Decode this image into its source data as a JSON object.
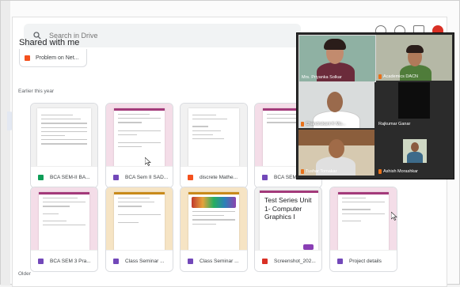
{
  "search": {
    "placeholder": "Search in Drive"
  },
  "page": {
    "heading": "Shared with me"
  },
  "previous_item": {
    "label": "Problem on Net..."
  },
  "sections": {
    "earlier": "Earlier this year",
    "older": "Older"
  },
  "row1": [
    {
      "label": "BCA SEM-II BA...",
      "icon": "sheets-icon",
      "icon_color": "#0f9d58"
    },
    {
      "label": "BCA Sem II SAD...",
      "icon": "forms-icon",
      "icon_color": "#7248b9"
    },
    {
      "label": "discrete Mathe...",
      "icon": "slides-icon",
      "icon_color": "#f4511e"
    },
    {
      "label": "BCA SEM",
      "icon": "forms-icon",
      "icon_color": "#7248b9"
    }
  ],
  "row2": [
    {
      "label": "BCA SEM 3 Pra...",
      "icon": "forms-icon",
      "icon_color": "#7248b9"
    },
    {
      "label": "Class Seminar ...",
      "icon": "forms-icon",
      "icon_color": "#7248b9"
    },
    {
      "label": "Class Seminar ...",
      "icon": "forms-icon",
      "icon_color": "#7248b9"
    },
    {
      "label": "Screenshot_202...",
      "icon": "image-icon",
      "icon_color": "#d93025"
    },
    {
      "label": "Project details",
      "icon": "forms-icon",
      "icon_color": "#7248b9"
    }
  ],
  "test_series_thumb": {
    "title": "Test Series Unit 1- Computer Graphics I"
  },
  "participants": [
    {
      "name": "Mrs. Priyanka Solkar"
    },
    {
      "name": "Academics DACN"
    },
    {
      "name": "Chandrakant K Mu..."
    },
    {
      "name": "Rajkumar Ganar"
    },
    {
      "name": "Tushar Tomakar"
    },
    {
      "name": "Ashish Morashkar"
    }
  ],
  "colors": {
    "forms": "#7248b9",
    "sheets": "#0f9d58",
    "slides": "#f4511e",
    "mic_off": "#e8711a"
  }
}
